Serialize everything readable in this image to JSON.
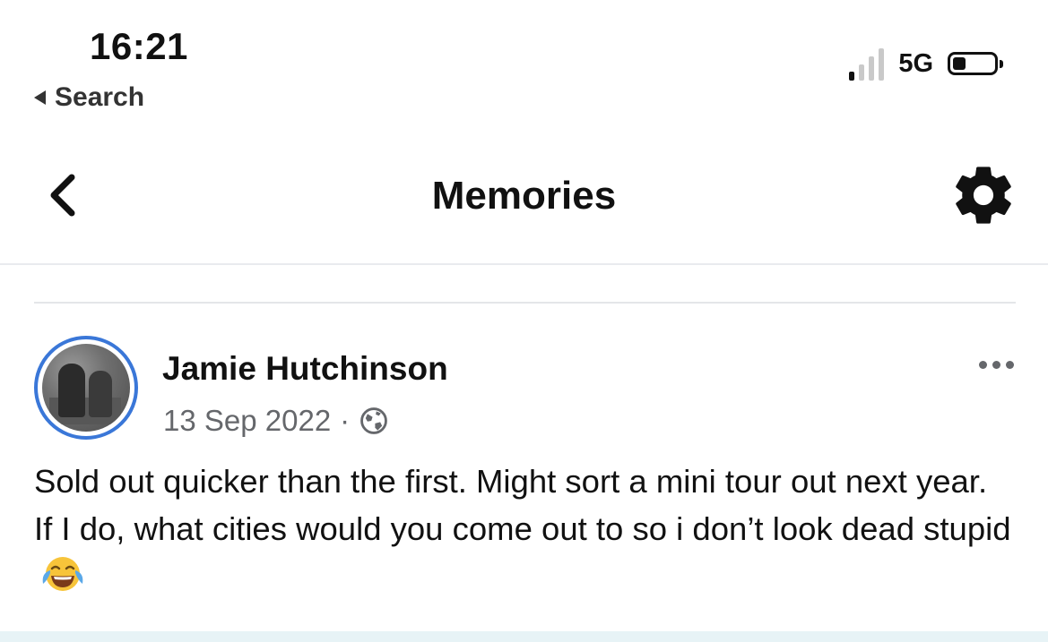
{
  "status_bar": {
    "time": "16:21",
    "back_app_label": "Search",
    "network": "5G",
    "signal_bars_on": 1,
    "signal_bars_total": 4,
    "battery_level": 0.3
  },
  "header": {
    "title": "Memories",
    "back_icon": "chevron-left-icon",
    "settings_icon": "gear-icon"
  },
  "post": {
    "author": "Jamie Hutchinson",
    "date": "13 Sep 2022",
    "separator": "·",
    "audience_icon": "globe-icon",
    "text": "Sold out quicker than the first. Might sort a mini tour out next year. If I do, what cities would you come out to so i don’t look dead stupid",
    "emoji": "face-with-tears-of-joy",
    "more_icon": "ellipsis-icon"
  },
  "colors": {
    "avatar_ring": "#3a77d8",
    "meta_text": "#65676b",
    "divider": "#e4e6e9",
    "bottom_strip": "#e7f3f6"
  }
}
